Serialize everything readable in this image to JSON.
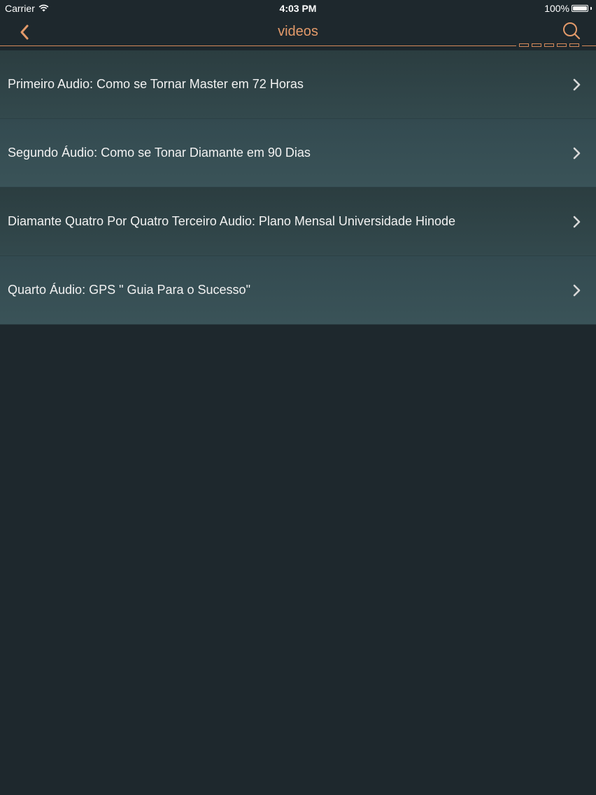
{
  "status_bar": {
    "carrier": "Carrier",
    "time": "4:03 PM",
    "battery_percent": "100%",
    "battery_level": 1.0
  },
  "nav": {
    "title": "videos",
    "back_icon": "chevron-left-icon",
    "search_icon": "search-icon",
    "accent_color": "#e39a6a"
  },
  "items": [
    {
      "label": "Primeiro Audio: Como se Tornar Master em 72 Horas"
    },
    {
      "label": "Segundo Áudio: Como se Tonar Diamante em 90 Dias"
    },
    {
      "label": "Diamante Quatro Por Quatro Terceiro Audio: Plano Mensal Universidade Hinode"
    },
    {
      "label": "Quarto Áudio: GPS \" Guia Para o Sucesso\""
    }
  ],
  "colors": {
    "background": "#1e282d",
    "text": "#f2f2f2",
    "accent": "#e39a6a"
  }
}
